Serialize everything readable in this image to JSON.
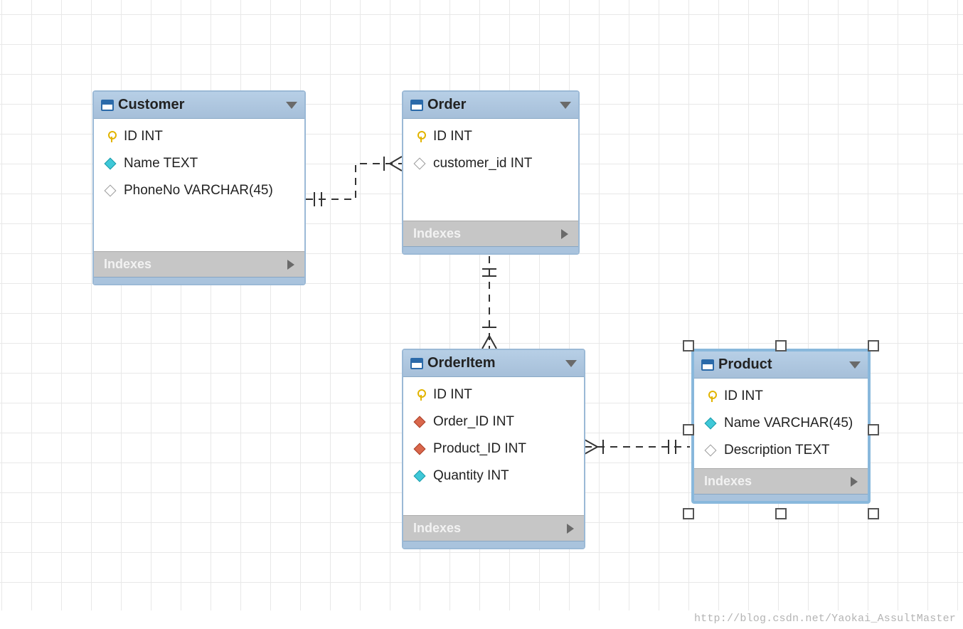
{
  "footer": {
    "watermark": "http://blog.csdn.net/Yaokai_AssultMaster"
  },
  "labels": {
    "indexes": "Indexes"
  },
  "entities": {
    "customer": {
      "title": "Customer",
      "columns": [
        {
          "icon": "key",
          "text": "ID INT"
        },
        {
          "icon": "cyan",
          "text": "Name TEXT"
        },
        {
          "icon": "hollow",
          "text": "PhoneNo VARCHAR(45)"
        }
      ]
    },
    "order": {
      "title": "Order",
      "columns": [
        {
          "icon": "key",
          "text": "ID INT"
        },
        {
          "icon": "hollow",
          "text": "customer_id INT"
        }
      ]
    },
    "orderitem": {
      "title": "OrderItem",
      "columns": [
        {
          "icon": "key",
          "text": "ID INT"
        },
        {
          "icon": "red",
          "text": "Order_ID INT"
        },
        {
          "icon": "red",
          "text": "Product_ID INT"
        },
        {
          "icon": "cyan",
          "text": "Quantity INT"
        }
      ]
    },
    "product": {
      "title": "Product",
      "columns": [
        {
          "icon": "key",
          "text": "ID INT"
        },
        {
          "icon": "cyan",
          "text": "Name VARCHAR(45)"
        },
        {
          "icon": "hollow",
          "text": "Description TEXT"
        }
      ],
      "selected": true
    }
  },
  "relationships": [
    {
      "from": "customer",
      "to": "order",
      "type": "one-to-many"
    },
    {
      "from": "order",
      "to": "orderitem",
      "type": "one-to-many"
    },
    {
      "from": "product",
      "to": "orderitem",
      "type": "one-to-many"
    }
  ]
}
